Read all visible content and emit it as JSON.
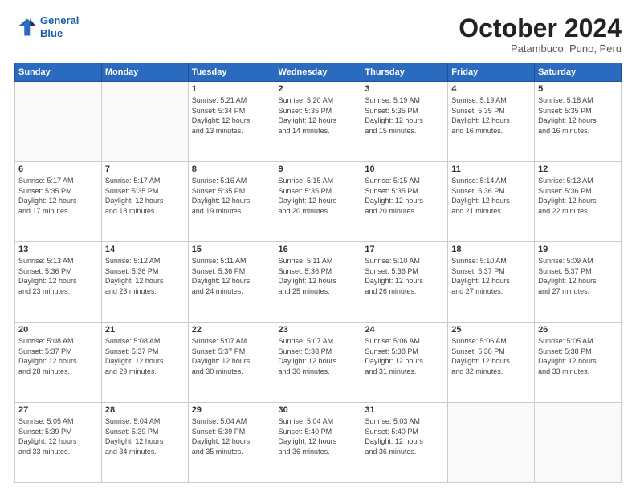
{
  "header": {
    "logo_line1": "General",
    "logo_line2": "Blue",
    "month": "October 2024",
    "location": "Patambuco, Puno, Peru"
  },
  "weekdays": [
    "Sunday",
    "Monday",
    "Tuesday",
    "Wednesday",
    "Thursday",
    "Friday",
    "Saturday"
  ],
  "weeks": [
    [
      {
        "day": "",
        "info": ""
      },
      {
        "day": "",
        "info": ""
      },
      {
        "day": "1",
        "info": "Sunrise: 5:21 AM\nSunset: 5:34 PM\nDaylight: 12 hours\nand 13 minutes."
      },
      {
        "day": "2",
        "info": "Sunrise: 5:20 AM\nSunset: 5:35 PM\nDaylight: 12 hours\nand 14 minutes."
      },
      {
        "day": "3",
        "info": "Sunrise: 5:19 AM\nSunset: 5:35 PM\nDaylight: 12 hours\nand 15 minutes."
      },
      {
        "day": "4",
        "info": "Sunrise: 5:19 AM\nSunset: 5:35 PM\nDaylight: 12 hours\nand 16 minutes."
      },
      {
        "day": "5",
        "info": "Sunrise: 5:18 AM\nSunset: 5:35 PM\nDaylight: 12 hours\nand 16 minutes."
      }
    ],
    [
      {
        "day": "6",
        "info": "Sunrise: 5:17 AM\nSunset: 5:35 PM\nDaylight: 12 hours\nand 17 minutes."
      },
      {
        "day": "7",
        "info": "Sunrise: 5:17 AM\nSunset: 5:35 PM\nDaylight: 12 hours\nand 18 minutes."
      },
      {
        "day": "8",
        "info": "Sunrise: 5:16 AM\nSunset: 5:35 PM\nDaylight: 12 hours\nand 19 minutes."
      },
      {
        "day": "9",
        "info": "Sunrise: 5:15 AM\nSunset: 5:35 PM\nDaylight: 12 hours\nand 20 minutes."
      },
      {
        "day": "10",
        "info": "Sunrise: 5:15 AM\nSunset: 5:35 PM\nDaylight: 12 hours\nand 20 minutes."
      },
      {
        "day": "11",
        "info": "Sunrise: 5:14 AM\nSunset: 5:36 PM\nDaylight: 12 hours\nand 21 minutes."
      },
      {
        "day": "12",
        "info": "Sunrise: 5:13 AM\nSunset: 5:36 PM\nDaylight: 12 hours\nand 22 minutes."
      }
    ],
    [
      {
        "day": "13",
        "info": "Sunrise: 5:13 AM\nSunset: 5:36 PM\nDaylight: 12 hours\nand 23 minutes."
      },
      {
        "day": "14",
        "info": "Sunrise: 5:12 AM\nSunset: 5:36 PM\nDaylight: 12 hours\nand 23 minutes."
      },
      {
        "day": "15",
        "info": "Sunrise: 5:11 AM\nSunset: 5:36 PM\nDaylight: 12 hours\nand 24 minutes."
      },
      {
        "day": "16",
        "info": "Sunrise: 5:11 AM\nSunset: 5:36 PM\nDaylight: 12 hours\nand 25 minutes."
      },
      {
        "day": "17",
        "info": "Sunrise: 5:10 AM\nSunset: 5:36 PM\nDaylight: 12 hours\nand 26 minutes."
      },
      {
        "day": "18",
        "info": "Sunrise: 5:10 AM\nSunset: 5:37 PM\nDaylight: 12 hours\nand 27 minutes."
      },
      {
        "day": "19",
        "info": "Sunrise: 5:09 AM\nSunset: 5:37 PM\nDaylight: 12 hours\nand 27 minutes."
      }
    ],
    [
      {
        "day": "20",
        "info": "Sunrise: 5:08 AM\nSunset: 5:37 PM\nDaylight: 12 hours\nand 28 minutes."
      },
      {
        "day": "21",
        "info": "Sunrise: 5:08 AM\nSunset: 5:37 PM\nDaylight: 12 hours\nand 29 minutes."
      },
      {
        "day": "22",
        "info": "Sunrise: 5:07 AM\nSunset: 5:37 PM\nDaylight: 12 hours\nand 30 minutes."
      },
      {
        "day": "23",
        "info": "Sunrise: 5:07 AM\nSunset: 5:38 PM\nDaylight: 12 hours\nand 30 minutes."
      },
      {
        "day": "24",
        "info": "Sunrise: 5:06 AM\nSunset: 5:38 PM\nDaylight: 12 hours\nand 31 minutes."
      },
      {
        "day": "25",
        "info": "Sunrise: 5:06 AM\nSunset: 5:38 PM\nDaylight: 12 hours\nand 32 minutes."
      },
      {
        "day": "26",
        "info": "Sunrise: 5:05 AM\nSunset: 5:38 PM\nDaylight: 12 hours\nand 33 minutes."
      }
    ],
    [
      {
        "day": "27",
        "info": "Sunrise: 5:05 AM\nSunset: 5:39 PM\nDaylight: 12 hours\nand 33 minutes."
      },
      {
        "day": "28",
        "info": "Sunrise: 5:04 AM\nSunset: 5:39 PM\nDaylight: 12 hours\nand 34 minutes."
      },
      {
        "day": "29",
        "info": "Sunrise: 5:04 AM\nSunset: 5:39 PM\nDaylight: 12 hours\nand 35 minutes."
      },
      {
        "day": "30",
        "info": "Sunrise: 5:04 AM\nSunset: 5:40 PM\nDaylight: 12 hours\nand 36 minutes."
      },
      {
        "day": "31",
        "info": "Sunrise: 5:03 AM\nSunset: 5:40 PM\nDaylight: 12 hours\nand 36 minutes."
      },
      {
        "day": "",
        "info": ""
      },
      {
        "day": "",
        "info": ""
      }
    ]
  ]
}
